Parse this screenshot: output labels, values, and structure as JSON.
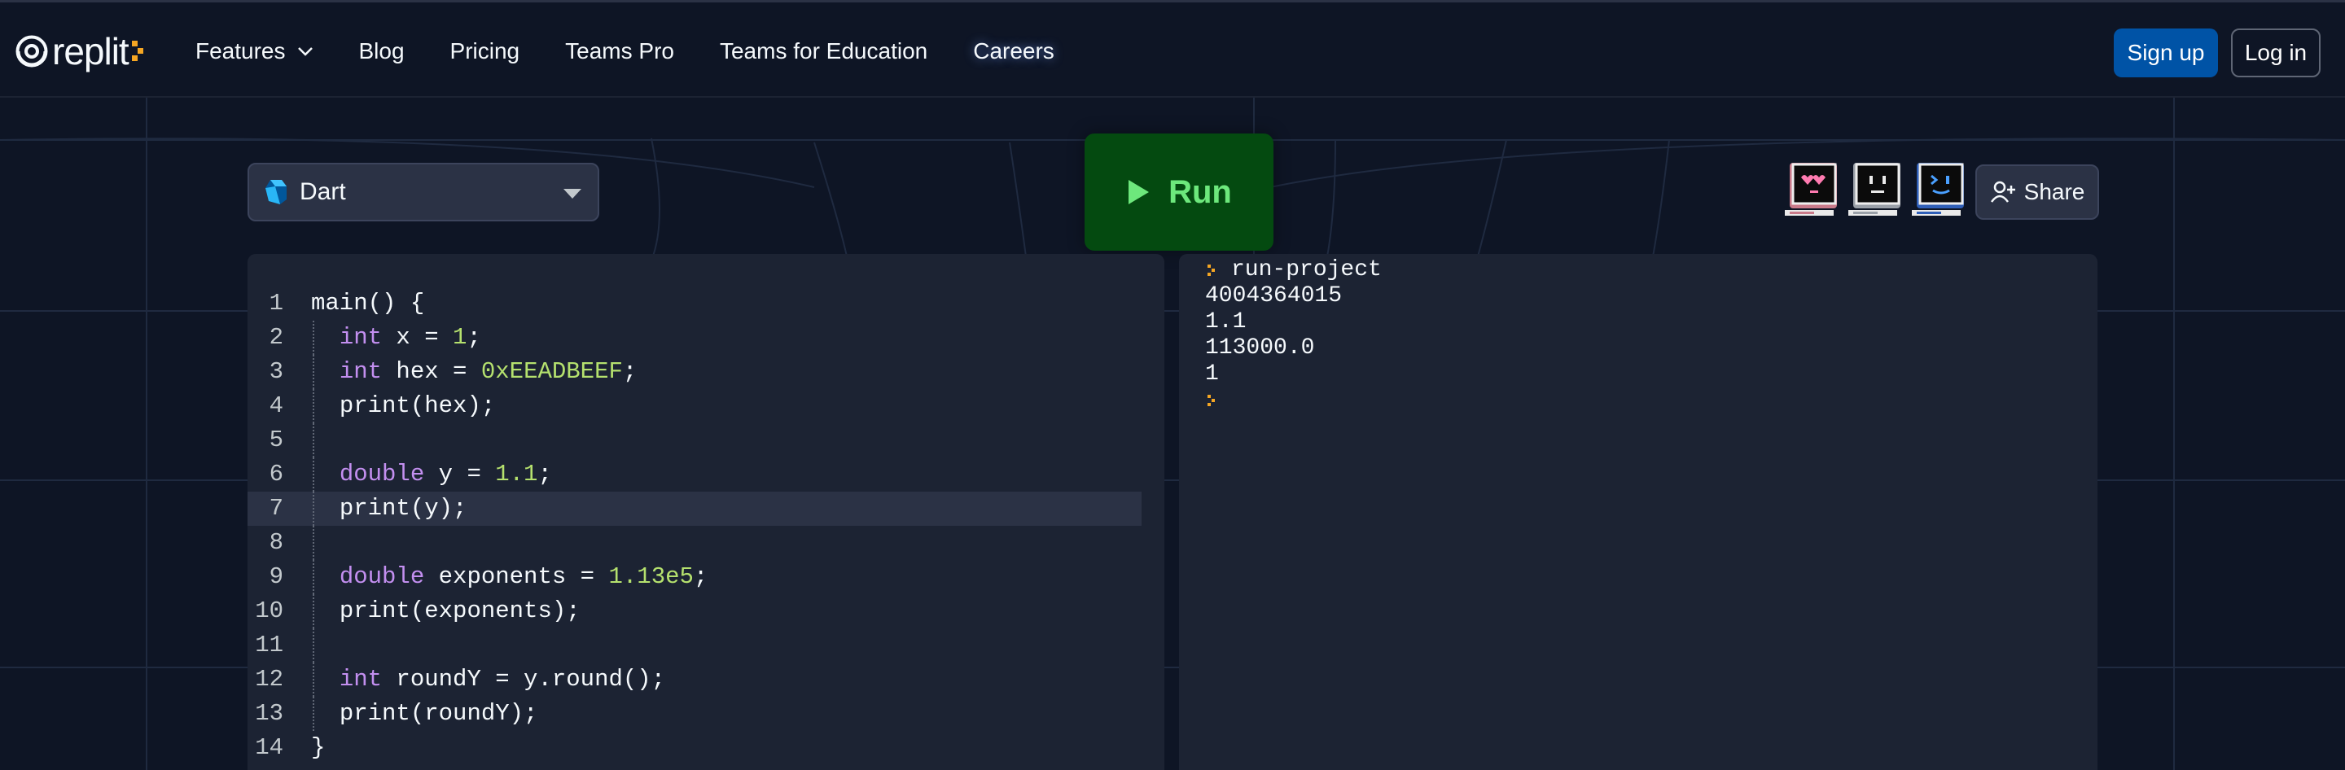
{
  "brand": {
    "name": "replit"
  },
  "nav": {
    "links": [
      {
        "label": "Features",
        "has_dropdown": true
      },
      {
        "label": "Blog"
      },
      {
        "label": "Pricing"
      },
      {
        "label": "Teams Pro"
      },
      {
        "label": "Teams for Education"
      },
      {
        "label": "Careers"
      }
    ],
    "signup_label": "Sign up",
    "login_label": "Log in"
  },
  "toolbar": {
    "language": "Dart",
    "run_label": "Run",
    "share_label": "Share",
    "avatars": [
      "heart-eyes-avatar-icon",
      "neutral-face-avatar-icon",
      "wink-face-avatar-icon"
    ]
  },
  "editor": {
    "lines": [
      {
        "n": "1",
        "indent": false,
        "tokens": [
          [
            "plain",
            "main() {"
          ]
        ]
      },
      {
        "n": "2",
        "indent": true,
        "tokens": [
          [
            "kw",
            "int"
          ],
          [
            "plain",
            " x = "
          ],
          [
            "num",
            "1"
          ],
          [
            "plain",
            ";"
          ]
        ]
      },
      {
        "n": "3",
        "indent": true,
        "tokens": [
          [
            "kw",
            "int"
          ],
          [
            "plain",
            " hex = "
          ],
          [
            "num",
            "0xEEADBEEF"
          ],
          [
            "plain",
            ";"
          ]
        ]
      },
      {
        "n": "4",
        "indent": true,
        "tokens": [
          [
            "plain",
            "print(hex);"
          ]
        ]
      },
      {
        "n": "5",
        "indent": true,
        "tokens": []
      },
      {
        "n": "6",
        "indent": true,
        "tokens": [
          [
            "kw",
            "double"
          ],
          [
            "plain",
            " y = "
          ],
          [
            "num",
            "1.1"
          ],
          [
            "plain",
            ";"
          ]
        ]
      },
      {
        "n": "7",
        "indent": true,
        "active": true,
        "tokens": [
          [
            "plain",
            "print(y);"
          ]
        ]
      },
      {
        "n": "8",
        "indent": true,
        "tokens": []
      },
      {
        "n": "9",
        "indent": true,
        "tokens": [
          [
            "kw",
            "double"
          ],
          [
            "plain",
            " exponents = "
          ],
          [
            "num",
            "1.13e5"
          ],
          [
            "plain",
            ";"
          ]
        ]
      },
      {
        "n": "10",
        "indent": true,
        "tokens": [
          [
            "plain",
            "print(exponents);"
          ]
        ]
      },
      {
        "n": "11",
        "indent": true,
        "tokens": []
      },
      {
        "n": "12",
        "indent": true,
        "tokens": [
          [
            "kw",
            "int"
          ],
          [
            "plain",
            " roundY = y.round();"
          ]
        ]
      },
      {
        "n": "13",
        "indent": true,
        "tokens": [
          [
            "plain",
            "print(roundY);"
          ]
        ]
      },
      {
        "n": "14",
        "indent": false,
        "tokens": [
          [
            "plain",
            "}"
          ]
        ]
      }
    ]
  },
  "console": {
    "command": "run-project",
    "output": [
      "4004364015",
      "1.1",
      "113000.0",
      "1"
    ]
  },
  "colors": {
    "background": "#0e1525",
    "panel": "#1c2333",
    "keyword": "#c38ff0",
    "number": "#b5e16e",
    "run_button": "#044a10",
    "run_text": "#6de87c",
    "signup": "#0053a6",
    "prompt": "#f5a623"
  }
}
